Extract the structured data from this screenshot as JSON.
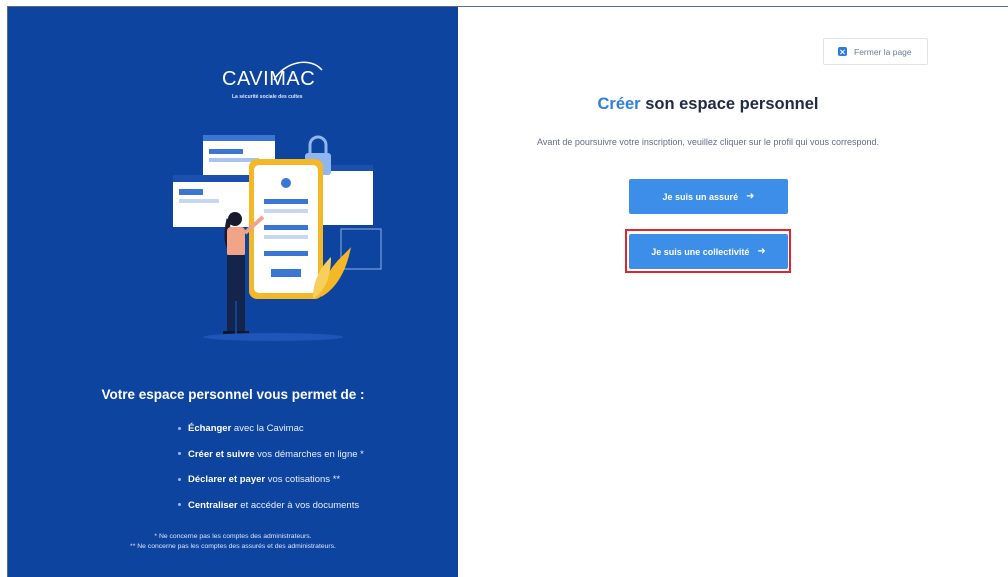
{
  "left_panel": {
    "logo_text": "CAVIMAC",
    "logo_tagline": "La sécurité sociale des cultes",
    "features_title": "Votre espace personnel vous permet de :",
    "features": [
      {
        "bold": "Échanger",
        "rest": " avec la Cavimac"
      },
      {
        "bold": "Créer et suivre",
        "rest": " vos démarches en ligne *"
      },
      {
        "bold": "Déclarer et payer",
        "rest": " vos cotisations **"
      },
      {
        "bold": "Centraliser",
        "rest": " et accéder à vos documents"
      }
    ],
    "footnote_1": "* Ne concerne pas les comptes des administrateurs.",
    "footnote_2": "** Ne concerne pas les comptes des assurés et des administrateurs."
  },
  "header": {
    "close_page_label": "Fermer la page"
  },
  "main": {
    "title_accent": "Créer",
    "title_rest": " son espace personnel",
    "subtitle": "Avant de poursuivre votre inscription, veuillez cliquer sur le profil qui vous correspond.",
    "btn_assure_label": "Je suis un assuré",
    "btn_collectivite_label": "Je suis une collectivité",
    "arrow_glyph": "➜"
  },
  "colors": {
    "left_bg": "#0d44a0",
    "accent": "#2f7fdb",
    "button": "#3c8ee8",
    "highlight": "#e0262b"
  }
}
